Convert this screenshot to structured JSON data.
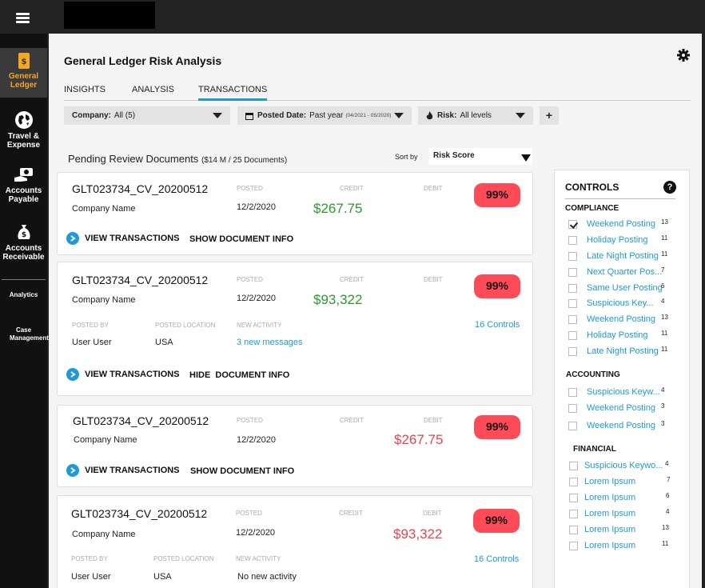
{
  "sidebar": {
    "items": [
      {
        "label": "General Ledger",
        "active": true
      },
      {
        "label": "Travel & Expense"
      },
      {
        "label": "Accounts Payable"
      },
      {
        "label": "Accounts Receivable"
      }
    ],
    "small_items": [
      {
        "label": "Analytics"
      },
      {
        "label": "Case Management"
      }
    ]
  },
  "page": {
    "title": "General Ledger Risk Analysis"
  },
  "tabs": [
    {
      "label": "INSIGHTS"
    },
    {
      "label": "ANALYSIS"
    },
    {
      "label": "TRANSACTIONS",
      "active": true
    }
  ],
  "filters": {
    "company": {
      "label": "Company:",
      "value": "All (5)"
    },
    "posted_date": {
      "label": "Posted Date:",
      "value": "Past year",
      "range": "(04/2021 - 05/2020)"
    },
    "risk": {
      "label": "Risk:",
      "value": "All levels"
    },
    "add_label": "+"
  },
  "pending": {
    "title": "Pending Review Documents",
    "summary": "($14 M / 25 Documents)",
    "sort_label": "Sort by",
    "sort_value": "Risk Score"
  },
  "labels": {
    "posted": "POSTED",
    "credit": "CREDIT",
    "debit": "DEBIT",
    "posted_by": "POSTED BY",
    "posted_location": "POSTED LOCATION",
    "new_activity": "NEW ACTIVITY",
    "view_transactions": "VIEW TRANSACTIONS",
    "show_info": "SHOW DOCUMENT INFO",
    "hide_info": "HIDE  DOCUMENT INFO"
  },
  "documents": [
    {
      "id": "GLT023734_CV_20200512",
      "company": "Company Name",
      "posted": "12/2/2020",
      "amount": "$267.75",
      "side": "credit",
      "risk": "99%"
    },
    {
      "id": "GLT023734_CV_20200512",
      "company": "Company Name",
      "posted": "12/2/2020",
      "amount": "$93,322",
      "side": "credit",
      "risk": "99%",
      "controls": "16 Controls",
      "posted_by": "User User",
      "location": "USA",
      "activity": "3 new messages"
    },
    {
      "id": "GLT023734_CV_20200512",
      "company": "Company Name",
      "posted": "12/2/2020",
      "amount": "$267.75",
      "side": "debit",
      "risk": "99%"
    },
    {
      "id": "GLT023734_CV_20200512",
      "company": "Company Name",
      "posted": "12/2/2020",
      "amount": "$93,322",
      "side": "debit",
      "risk": "99%",
      "controls": "16 Controls",
      "posted_by": "User User",
      "location": "USA",
      "activity": "No new activity"
    }
  ],
  "controls": {
    "title": "CONTROLS",
    "help": "?",
    "groups": [
      {
        "name": "COMPLIANCE",
        "items": [
          {
            "label": "Weekend Posting",
            "count": "13",
            "checked": true
          },
          {
            "label": "Holiday Posting",
            "count": "11"
          },
          {
            "label": "Late Night Posting",
            "count": "11"
          },
          {
            "label": "Next Quarter Pos...",
            "count": "7"
          },
          {
            "label": "Same User Posting",
            "count": "6"
          },
          {
            "label": "Suspicious Key...",
            "count": "4"
          },
          {
            "label": "Weekend Posting",
            "count": "13"
          },
          {
            "label": "Holiday Posting",
            "count": "11"
          },
          {
            "label": "Late Night Posting",
            "count": "11"
          }
        ]
      },
      {
        "name": "ACCOUNTING",
        "items": [
          {
            "label": "Suspicious Keyw...",
            "count": "4"
          },
          {
            "label": "Weekend Posting",
            "count": "3"
          },
          {
            "label": "Weekend Posting",
            "count": "3"
          }
        ]
      },
      {
        "name": "FINANCIAL",
        "items": [
          {
            "label": "Suspicious Keywo...",
            "count": "4"
          },
          {
            "label": "Lorem Ipsum",
            "count": "7"
          },
          {
            "label": "Lorem Ipsum",
            "count": "6"
          },
          {
            "label": "Lorem Ipsum",
            "count": "4"
          },
          {
            "label": "Lorem Ipsum",
            "count": "13"
          },
          {
            "label": "Lorem Ipsum",
            "count": "11"
          }
        ]
      }
    ]
  },
  "colors": {
    "accent": "#1e9ad6",
    "risk_badge": "#ff4a57",
    "credit_amount": "#2b9a2b",
    "debit_amount": "#e8434e",
    "active_sidebar": "#f5a623"
  }
}
